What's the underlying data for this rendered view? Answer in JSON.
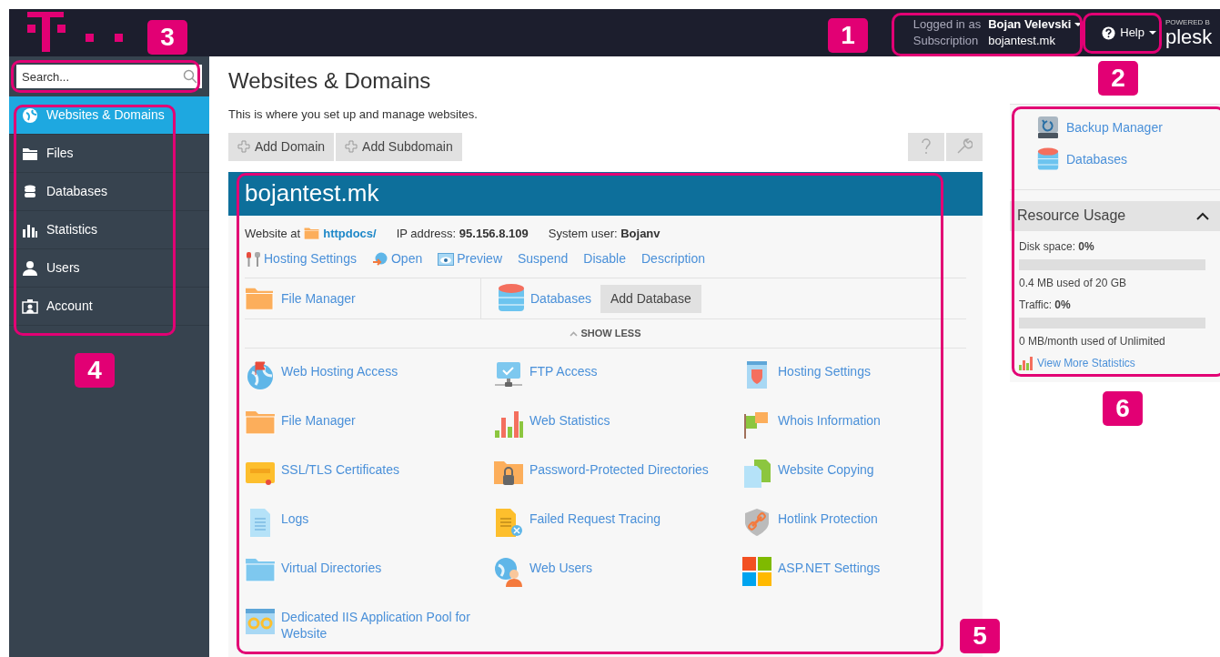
{
  "header": {
    "logged_in_label": "Logged in as",
    "user_name": "Bojan Velevski",
    "subscription_label": "Subscription",
    "subscription": "bojantest.mk",
    "help": "Help",
    "powered_by": "POWERED B",
    "brand": "plesk"
  },
  "sidebar": {
    "search": {
      "placeholder": "Search..."
    },
    "items": [
      {
        "label": "Websites & Domains",
        "selected": true
      },
      {
        "label": "Files",
        "selected": false
      },
      {
        "label": "Databases",
        "selected": false
      },
      {
        "label": "Statistics",
        "selected": false
      },
      {
        "label": "Users",
        "selected": false
      },
      {
        "label": "Account",
        "selected": false
      }
    ]
  },
  "main": {
    "title": "Websites & Domains",
    "description": "This is where you set up and manage websites.",
    "toolbar": [
      "Add Domain",
      "Add Subdomain"
    ],
    "domain": {
      "name": "bojantest.mk",
      "website_at": "Website at",
      "docroot": "httpdocs/",
      "ip": "IP address: **95.156.8.109**",
      "system_user": "System user: **Bojanv**",
      "actions": [
        "Hosting Settings",
        "Open",
        "Preview",
        "Suspend",
        "Disable",
        "Description"
      ],
      "file_manager": "File Manager",
      "databases": "Databases",
      "add_database": "Add Database",
      "show_less": "SHOW LESS",
      "tools": [
        "Web Hosting Access",
        "FTP Access",
        "Hosting Settings",
        "File Manager",
        "Web Statistics",
        "Whois Information",
        "SSL/TLS Certificates",
        "Password-Protected Directories",
        "Website Copying",
        "Logs",
        "Failed Request Tracing",
        "Hotlink Protection",
        "Virtual Directories",
        "Web Users",
        "ASP.NET Settings",
        "Dedicated IIS Application Pool for Website"
      ]
    }
  },
  "right": {
    "links": [
      "Backup Manager",
      "Databases"
    ],
    "resource_usage": {
      "title": "Resource Usage",
      "expanded": true,
      "meters": [
        {
          "label": "Disk space: **0%**",
          "level": 0,
          "detail": "0.4 MB used of 20 GB"
        },
        {
          "label": "Traffic: **0%**",
          "level": 0,
          "detail": "0 MB/month used of Unlimited"
        }
      ],
      "view_more": "View More Statistics"
    }
  },
  "annotations": [
    "1",
    "2",
    "3",
    "4",
    "5",
    "6"
  ]
}
